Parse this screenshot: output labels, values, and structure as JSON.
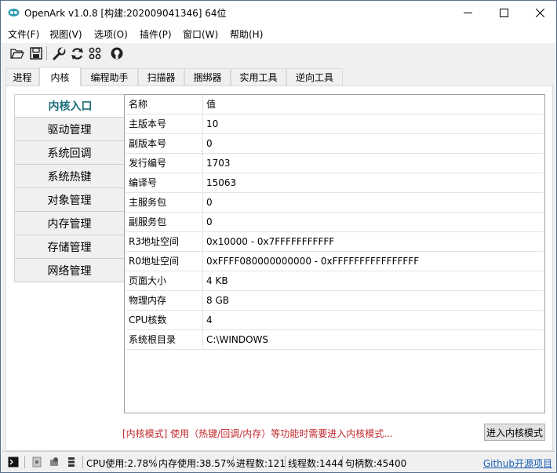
{
  "window": {
    "title": "OpenArk v1.0.8  [构建:202009041346]  64位"
  },
  "menu": [
    "文件(F)",
    "视图(V)",
    "选项(O)",
    "插件(P)",
    "窗口(W)",
    "帮助(H)"
  ],
  "toolbar": {
    "icons": [
      "open-folder-icon",
      "save-icon",
      "wrench-icon",
      "refresh-icon",
      "grid-icon",
      "github-icon"
    ]
  },
  "tabs": [
    "进程",
    "内核",
    "编程助手",
    "扫描器",
    "捆绑器",
    "实用工具",
    "逆向工具"
  ],
  "active_tab": "内核",
  "sidebar": [
    "内核入口",
    "驱动管理",
    "系统回调",
    "系统热键",
    "对象管理",
    "内存管理",
    "存储管理",
    "网络管理"
  ],
  "active_sidebar": "内核入口",
  "grid": {
    "rows": [
      [
        "名称",
        "值"
      ],
      [
        "主版本号",
        "10"
      ],
      [
        "副版本号",
        "0"
      ],
      [
        "发行编号",
        "1703"
      ],
      [
        "编译号",
        "15063"
      ],
      [
        "主服务包",
        "0"
      ],
      [
        "副服务包",
        "0"
      ],
      [
        "R3地址空间",
        "0x10000 - 0x7FFFFFFFFFFF"
      ],
      [
        "R0地址空间",
        "0xFFFF080000000000 - 0xFFFFFFFFFFFFFFFF"
      ],
      [
        "页面大小",
        "4 KB"
      ],
      [
        "物理内存",
        "8 GB"
      ],
      [
        "CPU核数",
        "4"
      ],
      [
        "系统根目录",
        "C:\\WINDOWS"
      ]
    ]
  },
  "hint": "[内核模式] 使用（热键/回调/内存）等功能时需要进入内核模式...",
  "enter_button": "进入内核模式",
  "status": {
    "cpu": "CPU使用:2.78%",
    "mem": "内存使用:38.57%",
    "procs": "进程数:121",
    "threads": "线程数:1444",
    "handles": "句柄数:45400",
    "link": "Github开源项目"
  },
  "colors": {
    "accent": "#1a6f78",
    "hint_red": "#c0282d",
    "link_blue": "#1a5fb4"
  }
}
